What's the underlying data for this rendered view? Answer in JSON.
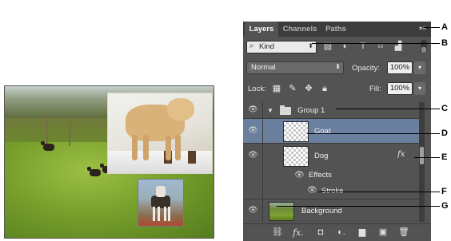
{
  "panel": {
    "tabs": [
      {
        "label": "Layers",
        "active": true
      },
      {
        "label": "Channels",
        "active": false
      },
      {
        "label": "Paths",
        "active": false
      }
    ],
    "menu_icon": "panel-menu-icon",
    "filter": {
      "kind_label": "Kind",
      "kind_icon": "search-icon",
      "filter_icons": [
        "image-filter-icon",
        "adjustment-filter-icon",
        "type-filter-icon",
        "shape-filter-icon",
        "smart-object-filter-icon"
      ]
    },
    "blend_mode": "Normal",
    "opacity_label": "Opacity:",
    "opacity_value": "100%",
    "lock_label": "Lock:",
    "fill_label": "Fill:",
    "fill_value": "100%",
    "layers": [
      {
        "name": "Group 1",
        "type": "group",
        "visible": true
      },
      {
        "name": "Goat",
        "type": "pixel",
        "visible": true,
        "selected": true
      },
      {
        "name": "Dog",
        "type": "pixel",
        "visible": true,
        "fx": "fx"
      },
      {
        "name": "Effects",
        "type": "effects-header",
        "visible": true
      },
      {
        "name": "Stroke",
        "type": "effect",
        "visible": true
      },
      {
        "name": "Background",
        "type": "pixel",
        "visible": true
      }
    ],
    "bottom_icons": [
      "link-layers-icon",
      "add-layer-style-icon",
      "add-mask-icon",
      "adjustment-layer-icon",
      "new-group-icon",
      "new-layer-icon",
      "delete-layer-icon"
    ],
    "bottom_glyphs": {
      "link": "⛓",
      "fx": "fx.",
      "mask": "◘",
      "adjust": "◐.",
      "group": "▆",
      "new": "▣",
      "trash": "🗑"
    }
  },
  "callouts": [
    "A",
    "B",
    "C",
    "D",
    "E",
    "F",
    "G"
  ],
  "colors": {
    "panel_bg": "#535353",
    "tab_bar": "#3c3c3c",
    "selected_layer": "#6b7f9f"
  }
}
